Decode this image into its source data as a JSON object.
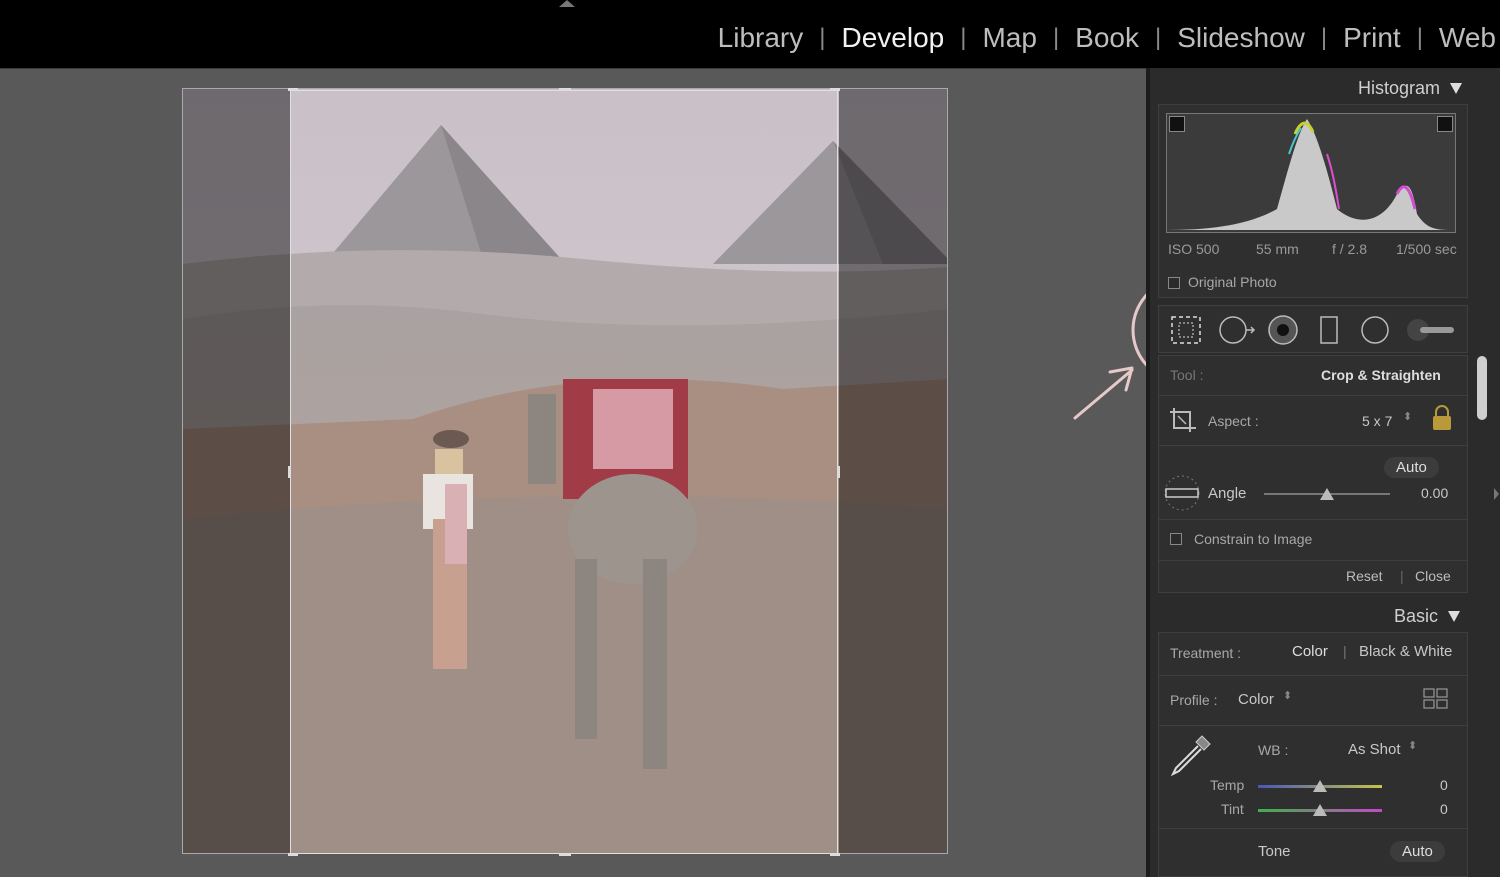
{
  "modules": [
    {
      "label": "Library",
      "active": false
    },
    {
      "label": "Develop",
      "active": true
    },
    {
      "label": "Map",
      "active": false
    },
    {
      "label": "Book",
      "active": false
    },
    {
      "label": "Slideshow",
      "active": false
    },
    {
      "label": "Print",
      "active": false
    },
    {
      "label": "Web",
      "active": false
    }
  ],
  "histogram": {
    "title": "Histogram",
    "iso": "ISO 500",
    "focal": "55 mm",
    "aperture": "f / 2.8",
    "shutter": "1/500 sec",
    "original_photo_label": "Original Photo"
  },
  "tools": {
    "icons": [
      "crop-overlay-icon",
      "spot-removal-icon",
      "red-eye-icon",
      "graduated-filter-icon",
      "radial-filter-icon",
      "adjustment-brush-icon"
    ],
    "tool_label": "Tool :",
    "tool_value": "Crop & Straighten"
  },
  "crop": {
    "aspect_label": "Aspect :",
    "aspect_value": "5 x 7",
    "auto_label": "Auto",
    "angle_label": "Angle",
    "angle_value": "0.00",
    "constrain_label": "Constrain to Image",
    "reset_label": "Reset",
    "close_label": "Close"
  },
  "basic": {
    "title": "Basic",
    "treatment_label": "Treatment :",
    "treatment_color": "Color",
    "treatment_bw": "Black & White",
    "profile_label": "Profile :",
    "profile_value": "Color",
    "wb_label": "WB :",
    "wb_value": "As Shot",
    "temp_label": "Temp",
    "temp_value": "0",
    "tint_label": "Tint",
    "tint_value": "0",
    "tone_label": "Tone",
    "tone_auto": "Auto"
  },
  "colors": {
    "highlight_circle": "#e8c9c9",
    "lock": "#b89a3a"
  }
}
